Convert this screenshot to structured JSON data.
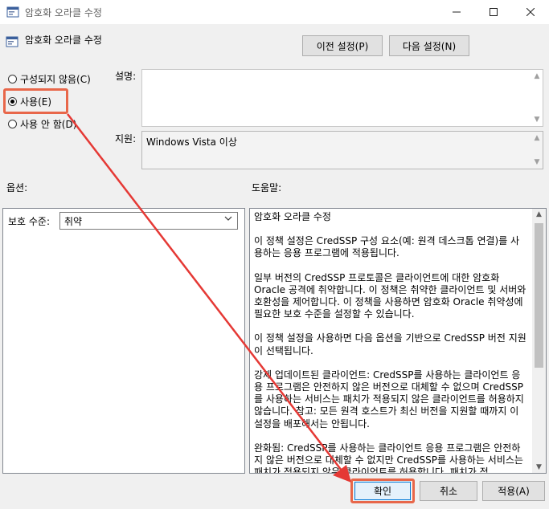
{
  "window": {
    "title": "암호화 오라클 수정"
  },
  "caption_buttons": {
    "minimize": "—",
    "maximize": "☐",
    "close": "✕"
  },
  "header": {
    "title": "암호화 오라클 수정",
    "prev_label": "이전 설정(P)",
    "next_label": "다음 설정(N)"
  },
  "state": {
    "not_configured": "구성되지 않음(C)",
    "enabled": "사용(E)",
    "disabled": "사용 안 함(D)",
    "selected": "enabled"
  },
  "labels": {
    "description": "설명:",
    "supported": "지원:",
    "options": "옵션:",
    "help": "도움말:"
  },
  "supported_text": "Windows Vista 이상",
  "options": {
    "level_label": "보호 수준:",
    "level_value": "취약"
  },
  "help": {
    "paragraphs": [
      "암호화 오라클 수정",
      "이 정책 설정은 CredSSP 구성 요소(예: 원격 데스크톱 연결)를 사용하는 응용 프로그램에 적용됩니다.",
      "일부 버전의 CredSSP 프로토콜은 클라이언트에 대한 암호화 Oracle 공격에 취약합니다.  이 정책은 취약한 클라이언트 및 서버와 호환성을 제어합니다.  이 정책을 사용하면 암호화 Oracle 취약성에 필요한 보호 수준을 설정할 수 있습니다.",
      "이 정책 설정을 사용하면 다음 옵션을 기반으로 CredSSP 버전 지원이 선택됩니다.",
      "강제 업데이트된 클라이언트: CredSSP를 사용하는 클라이언트 응용 프로그램은 안전하지 않은 버전으로 대체할 수 없으며 CredSSP를 사용하는 서비스는 패치가 적용되지 않은 클라이언트를 허용하지 않습니다. 참고: 모든 원격 호스트가 최신 버전을 지원할 때까지 이 설정을 배포해서는 안됩니다.",
      "완화됨: CredSSP를 사용하는 클라이언트 응용 프로그램은 안전하지 않은 버전으로 대체할 수 없지만 CredSSP를 사용하는 서비스는 패치가 적용되지 않은 클라이언트를 허용합니다. 패치가 적"
    ]
  },
  "footer": {
    "ok_label": "확인",
    "cancel_label": "취소",
    "apply_label": "적용(A)"
  },
  "icons": [
    "policy-icon",
    "chevron-down-icon",
    "scroll-up-icon",
    "scroll-down-icon"
  ],
  "colors": {
    "annotation": "#e8674a",
    "arrow": "#e53935",
    "accent": "#0078d7"
  }
}
